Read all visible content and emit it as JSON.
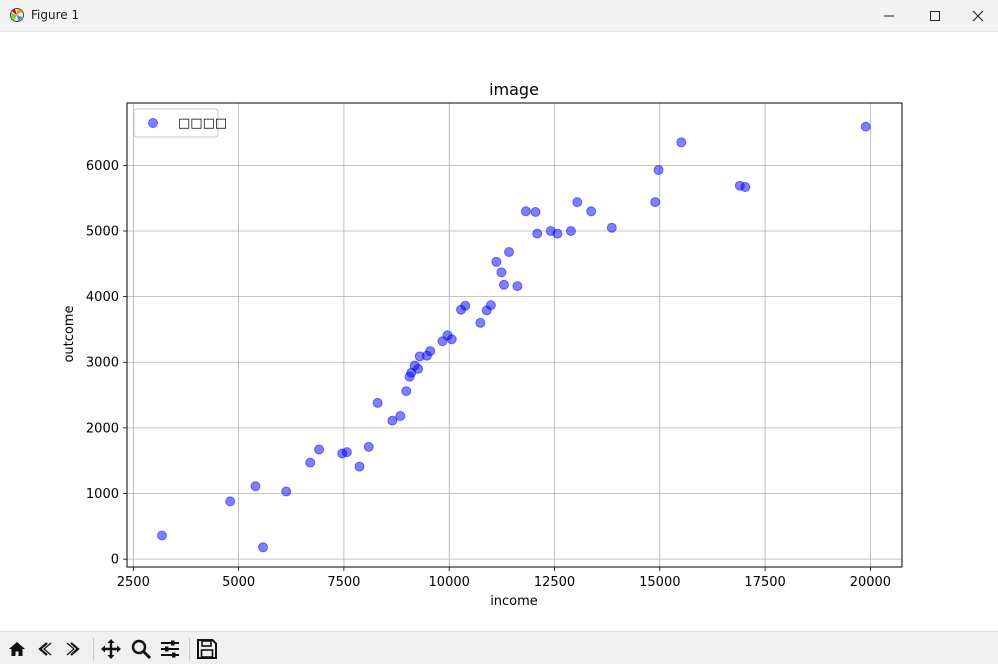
{
  "window": {
    "title": "Figure 1"
  },
  "toolbar": {
    "icons": [
      "home-icon",
      "back-icon",
      "forward-icon",
      "pan-icon",
      "zoom-icon",
      "configure-subplots-icon",
      "save-icon"
    ]
  },
  "chart_data": {
    "type": "scatter",
    "title": "image",
    "xlabel": "income",
    "ylabel": "outcome",
    "xlim": [
      2350,
      20750
    ],
    "ylim": [
      -120,
      6950
    ],
    "xticks": [
      2500,
      5000,
      7500,
      10000,
      12500,
      15000,
      17500,
      20000
    ],
    "yticks": [
      0,
      1000,
      2000,
      3000,
      4000,
      5000,
      6000
    ],
    "grid": true,
    "legend": {
      "position": "upper-left",
      "label": "□□□□"
    },
    "marker_color": "#0000ff",
    "marker_alpha": 0.5,
    "series": [
      {
        "name": "□□□□",
        "points": [
          [
            3180,
            360
          ],
          [
            4800,
            880
          ],
          [
            5400,
            1110
          ],
          [
            5580,
            180
          ],
          [
            6130,
            1030
          ],
          [
            6700,
            1470
          ],
          [
            6910,
            1670
          ],
          [
            7460,
            1610
          ],
          [
            7570,
            1630
          ],
          [
            7870,
            1410
          ],
          [
            8090,
            1710
          ],
          [
            8300,
            2380
          ],
          [
            8650,
            2110
          ],
          [
            8840,
            2180
          ],
          [
            8980,
            2560
          ],
          [
            9060,
            2780
          ],
          [
            9100,
            2840
          ],
          [
            9180,
            2950
          ],
          [
            9260,
            2900
          ],
          [
            9300,
            3090
          ],
          [
            9470,
            3100
          ],
          [
            9550,
            3170
          ],
          [
            9840,
            3320
          ],
          [
            9960,
            3410
          ],
          [
            10060,
            3350
          ],
          [
            10280,
            3800
          ],
          [
            10380,
            3860
          ],
          [
            10740,
            3600
          ],
          [
            10890,
            3790
          ],
          [
            10990,
            3870
          ],
          [
            11120,
            4530
          ],
          [
            11240,
            4370
          ],
          [
            11300,
            4180
          ],
          [
            11420,
            4680
          ],
          [
            11620,
            4160
          ],
          [
            11820,
            5300
          ],
          [
            12050,
            5290
          ],
          [
            12090,
            4960
          ],
          [
            12410,
            5000
          ],
          [
            12570,
            4960
          ],
          [
            12890,
            5000
          ],
          [
            13040,
            5440
          ],
          [
            13370,
            5300
          ],
          [
            13860,
            5050
          ],
          [
            14890,
            5440
          ],
          [
            14970,
            5930
          ],
          [
            15510,
            6350
          ],
          [
            16900,
            5690
          ],
          [
            17030,
            5670
          ],
          [
            19890,
            6590
          ]
        ]
      }
    ]
  }
}
